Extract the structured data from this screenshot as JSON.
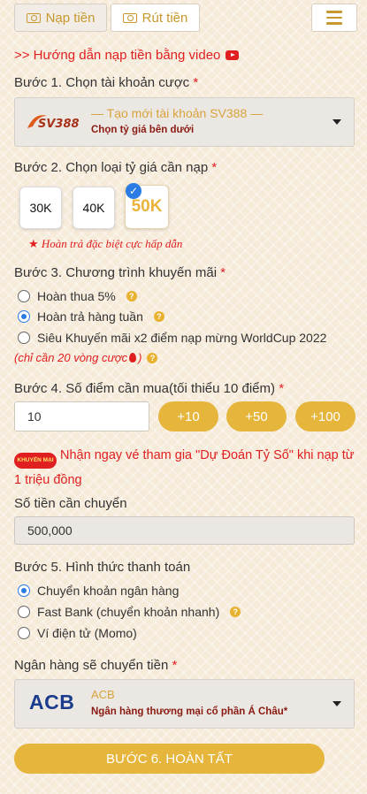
{
  "header": {
    "tab_deposit": "Nạp tiền",
    "tab_withdraw": "Rút tiền",
    "menu_icon": "hamburger-icon",
    "accent": "#c8972d"
  },
  "guide_link": ">> Hướng dẫn nạp tiền bằng video",
  "step1": {
    "label": "Bước 1. Chọn tài khoản cược",
    "required": "*",
    "logo_text": "SV388",
    "selected_title": "— Tạo mới tài khoản SV388 —",
    "selected_sub": "Chọn tỷ giá bên dưới"
  },
  "step2": {
    "label": "Bước 2. Chọn loại tỷ giá cần nạp",
    "required": "*",
    "rates": [
      "30K",
      "40K",
      "50K"
    ],
    "selected_rate": "50K",
    "note": "Hoàn trả đặc biệt cực hấp dẫn"
  },
  "step3": {
    "label": "Bước 3. Chương trình khuyến mãi",
    "required": "*",
    "options": [
      "Hoàn thua 5%",
      "Hoàn trả hàng tuần",
      "Siêu Khuyến mãi x2 điểm nạp mừng WorldCup 2022"
    ],
    "selected": "Hoàn trả hàng tuần",
    "condition": "(chỉ cần 20 vòng cược"
  },
  "step4": {
    "label": "Bước 4. Số điểm cần mua(tối thiểu 10 điểm)",
    "required": "*",
    "points_value": "10",
    "quick_add": [
      "+10",
      "+50",
      "+100"
    ],
    "badge": "KHUYẾN MẠI",
    "promo_text": "Nhận ngay vé tham gia \"Dự Đoán Tỷ Số\" khi nạp từ 1 triệu đồng"
  },
  "transfer": {
    "label": "Số tiền cần chuyển",
    "amount": "500,000"
  },
  "step5": {
    "label": "Bước 5. Hình thức thanh toán",
    "options": [
      "Chuyển khoản ngân hàng",
      "Fast Bank (chuyển khoản nhanh)",
      "Ví điện tử (Momo)"
    ],
    "selected": "Chuyển khoản ngân hàng"
  },
  "bank": {
    "label": "Ngân hàng sẽ chuyển tiền",
    "required": "*",
    "logo_text": "ACB",
    "name": "ACB",
    "full_name": "Ngân hàng thương mại cổ phần Á Châu*"
  },
  "finish_button": "BƯỚC 6. HOÀN TẤT"
}
